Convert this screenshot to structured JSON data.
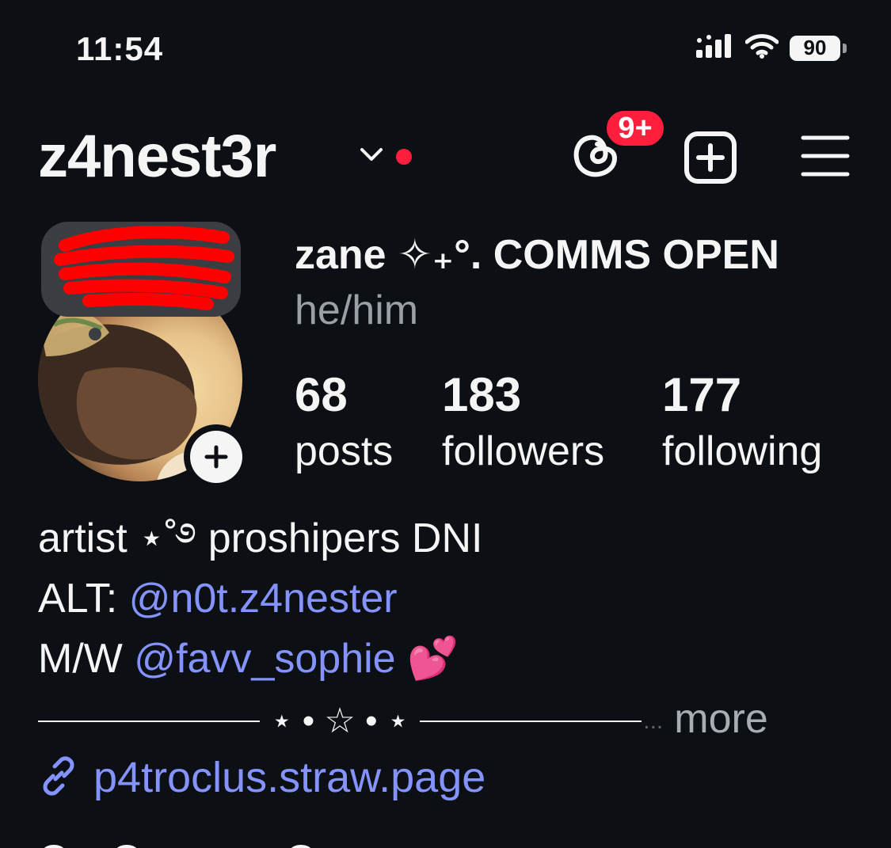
{
  "status_bar": {
    "time": "11:54",
    "battery": "90",
    "icons": [
      "cellular-icon",
      "wifi-icon",
      "battery-icon"
    ]
  },
  "header": {
    "username": "z4nest3r",
    "notification_badge": "9+",
    "icons": [
      "chevron-down-icon",
      "threads-icon",
      "new-post-icon",
      "menu-icon"
    ]
  },
  "profile": {
    "display_name": "zane ✧₊°. COMMS OPEN",
    "pronouns": "he/him",
    "stats": [
      {
        "value": "68",
        "label": "posts"
      },
      {
        "value": "183",
        "label": "followers"
      },
      {
        "value": "177",
        "label": "following"
      }
    ]
  },
  "bio": {
    "line1": "artist ⋆˚࿔ proshipers DNI",
    "alt_prefix": "ALT:",
    "alt_mention": "@n0t.z4nester",
    "mw_prefix": "M/W",
    "mw_mention": "@favv_sophie",
    "mw_emoji": "💕",
    "divider_deco": "⋆ • ☆ • ⋆",
    "ellipsis": "...",
    "more": "more"
  },
  "link": {
    "url": "p4troclus.straw.page"
  },
  "colors": {
    "background": "#0c1014",
    "accent_link": "#8593ff",
    "badge_red": "#ff1f3d",
    "muted_text": "#9aa0a6"
  }
}
